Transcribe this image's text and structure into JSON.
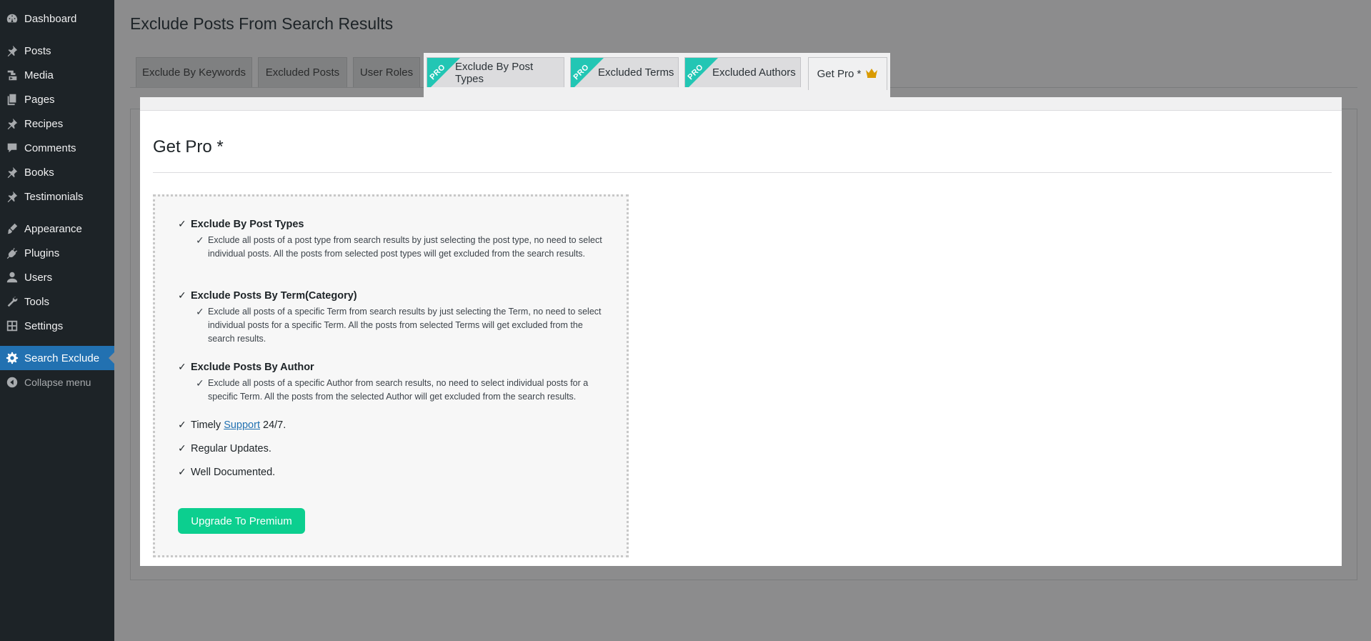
{
  "page_title": "Exclude Posts From Search Results",
  "sidebar": {
    "items": [
      {
        "label": "Dashboard",
        "icon": "dashboard-icon"
      },
      {
        "label": "Posts",
        "icon": "pin-icon"
      },
      {
        "label": "Media",
        "icon": "media-icon"
      },
      {
        "label": "Pages",
        "icon": "pages-icon"
      },
      {
        "label": "Recipes",
        "icon": "pin-icon"
      },
      {
        "label": "Comments",
        "icon": "comment-icon"
      },
      {
        "label": "Books",
        "icon": "pin-icon"
      },
      {
        "label": "Testimonials",
        "icon": "pin-icon"
      },
      {
        "label": "Appearance",
        "icon": "brush-icon"
      },
      {
        "label": "Plugins",
        "icon": "plug-icon"
      },
      {
        "label": "Users",
        "icon": "user-icon"
      },
      {
        "label": "Tools",
        "icon": "wrench-icon"
      },
      {
        "label": "Settings",
        "icon": "settings-icon"
      },
      {
        "label": "Search Exclude",
        "icon": "gear-icon"
      }
    ],
    "collapse_label": "Collapse menu"
  },
  "tabs": {
    "keywords": "Exclude By Keywords",
    "excluded_posts": "Excluded Posts",
    "user_roles": "User Roles",
    "post_types": "Exclude By Post Types",
    "terms": "Excluded Terms",
    "authors": "Excluded Authors",
    "get_pro": "Get Pro *",
    "pro_badge": "PRO"
  },
  "panel": {
    "title": "Get Pro *",
    "check": "✓",
    "features": {
      "post_types_title": "Exclude By Post Types",
      "post_types_desc": "Exclude all posts of a post type from search results by just selecting the post type, no need to select individual posts. All the posts from selected post types will get excluded from the search results.",
      "term_title": "Exclude Posts By Term(Category)",
      "term_desc": "Exclude all posts of a specific Term from search results by just selecting the Term, no need to select individual posts for a specific Term. All the posts from selected Terms will get excluded from the search results.",
      "author_title": "Exclude Posts By Author",
      "author_desc": "Exclude all posts of a specific Author from search results, no need to select individual posts for a specific Term. All the posts from the selected Author will get excluded from the search results.",
      "support_prefix": "Timely",
      "support_link": "Support",
      "support_suffix": "24/7.",
      "updates": "Regular Updates.",
      "documented": "Well Documented."
    },
    "upgrade_label": "Upgrade To Premium"
  },
  "colors": {
    "accent": "#2271b1",
    "pro_ribbon": "#22c6b4",
    "upgrade_button": "#0ccf8f",
    "sidebar_bg": "#1d2327"
  }
}
